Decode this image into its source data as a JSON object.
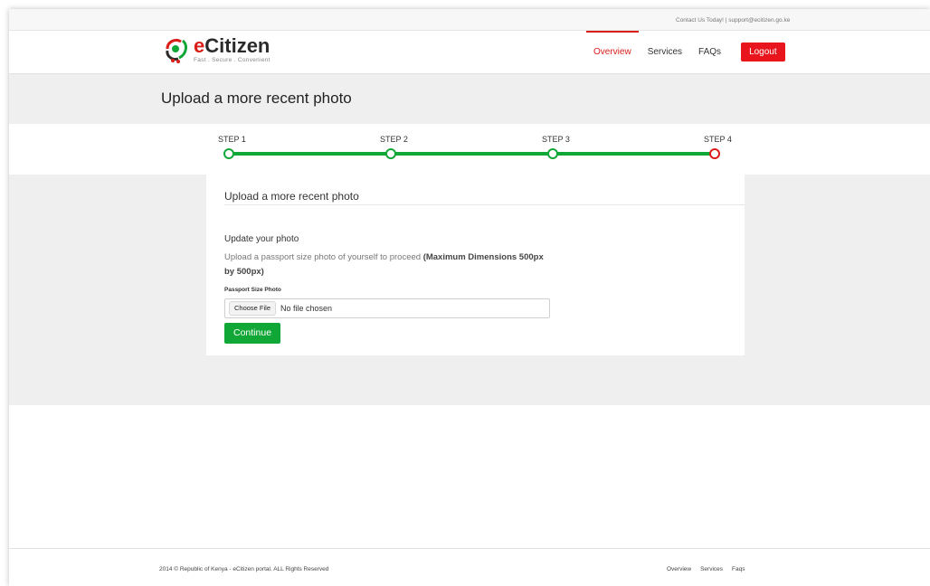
{
  "topbar": {
    "contact_text": "Contact Us Today! | support@ecitizen.go.ke"
  },
  "brand": {
    "name_initial": "e",
    "name_rest": "Citizen",
    "tagline": "Fast . Secure . Convenient",
    "colors": {
      "red": "#d91e18",
      "green": "#11a737",
      "black": "#2b2b2b"
    }
  },
  "nav": {
    "items": [
      {
        "label": "Overview",
        "active": true
      },
      {
        "label": "Services",
        "active": false
      },
      {
        "label": "FAQs",
        "active": false
      }
    ],
    "logout_label": "Logout"
  },
  "page": {
    "title": "Upload a more recent photo"
  },
  "steps": [
    {
      "label": "STEP 1",
      "state": "done"
    },
    {
      "label": "STEP 2",
      "state": "done"
    },
    {
      "label": "STEP 3",
      "state": "done"
    },
    {
      "label": "STEP 4",
      "state": "current"
    }
  ],
  "card": {
    "title": "Upload a more recent photo",
    "section_heading": "Update your photo",
    "description": "Upload a passport size photo of yourself to proceed ",
    "description_bold": "(Maximum Dimensions 500px by 500px)",
    "field_label": "Passport Size Photo",
    "choose_file_label": "Choose File",
    "no_file_text": "No file chosen",
    "continue_label": "Continue"
  },
  "footer": {
    "copyright": "2014 © Republic of Kenya - eCitizen portal. ALL Rights Reserved",
    "links": [
      "Overview",
      "Services",
      "Faqs"
    ]
  }
}
